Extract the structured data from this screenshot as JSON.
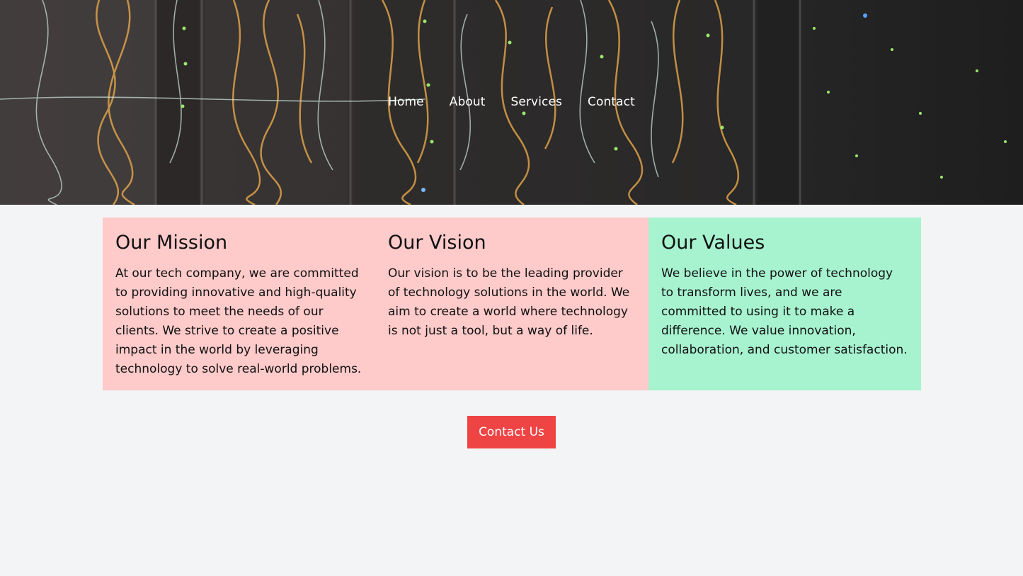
{
  "nav": {
    "items": [
      {
        "label": "Home"
      },
      {
        "label": "About"
      },
      {
        "label": "Services"
      },
      {
        "label": "Contact"
      }
    ]
  },
  "cards": [
    {
      "title": "Our Mission",
      "text": "At our tech company, we are committed to providing innovative and high-quality solutions to meet the needs of our clients. We strive to create a positive impact in the world by leveraging technology to solve real-world problems.",
      "color": "#fecaca"
    },
    {
      "title": "Our Vision",
      "text": "Our vision is to be the leading provider of technology solutions in the world. We aim to create a world where technology is not just a tool, but a way of life.",
      "color": "#fecaca"
    },
    {
      "title": "Our Values",
      "text": "We believe in the power of technology to transform lives, and we are committed to using it to make a difference. We value innovation, collaboration, and customer satisfaction.",
      "color": "#a7f3d0"
    }
  ],
  "cta": {
    "label": "Contact Us",
    "color": "#ef4444"
  },
  "hero": {
    "image": "server-rack-cables-photo"
  }
}
